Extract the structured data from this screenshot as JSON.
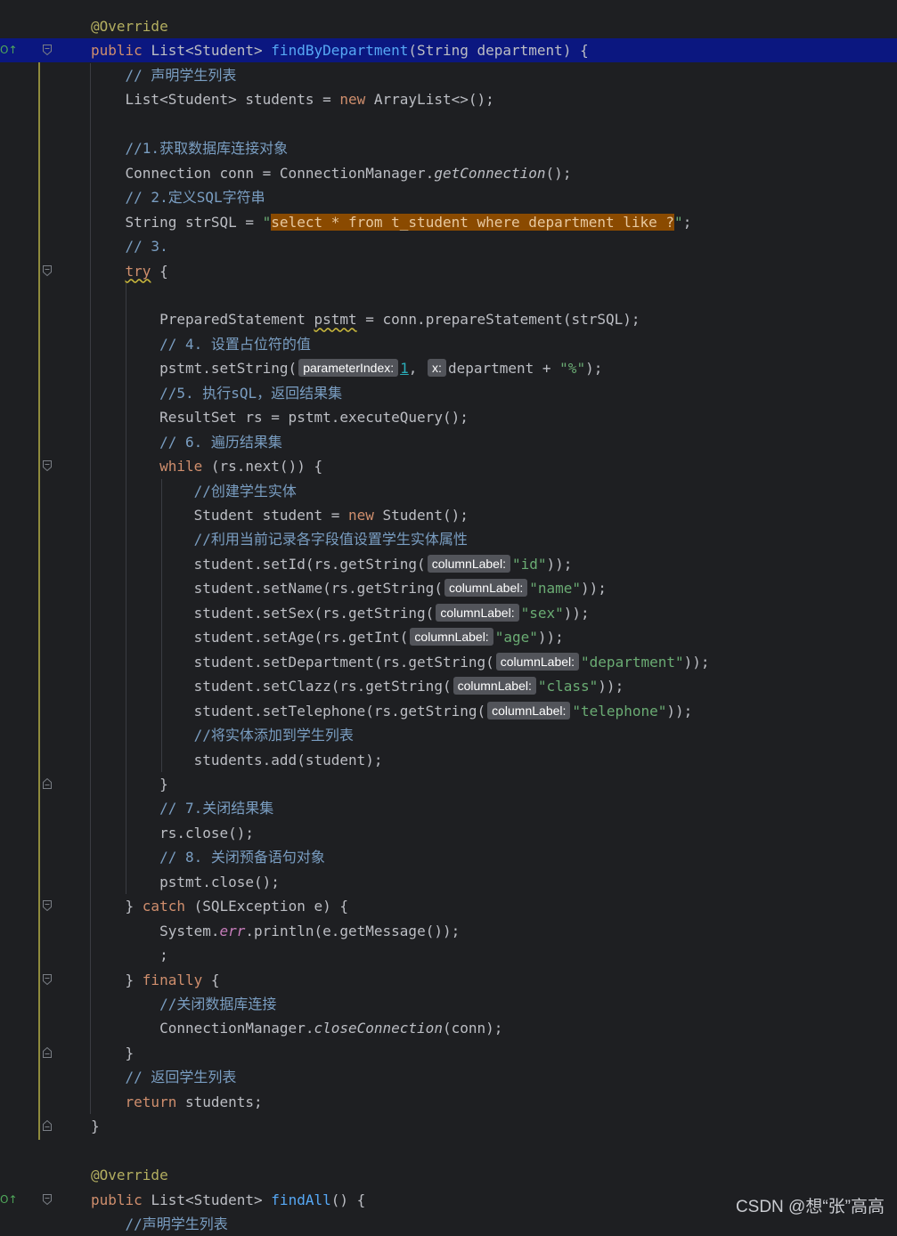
{
  "editor": {
    "lines": [
      [
        {
          "t": "@Override",
          "c": "a"
        }
      ],
      [
        {
          "t": "public ",
          "c": "k"
        },
        {
          "t": "List<Student> "
        },
        {
          "t": "findByDepartment",
          "c": "fn"
        },
        {
          "t": "(String department) {"
        }
      ],
      [
        {
          "t": "    // 声明学生列表",
          "c": "c"
        }
      ],
      [
        {
          "t": "    List<Student> students = "
        },
        {
          "t": "new ",
          "c": "k"
        },
        {
          "t": "ArrayList<>();"
        }
      ],
      [],
      [
        {
          "t": "    //1.获取数据库连接对象",
          "c": "c"
        }
      ],
      [
        {
          "t": "    Connection conn = ConnectionManager."
        },
        {
          "t": "getConnection",
          "c": "it"
        },
        {
          "t": "();"
        }
      ],
      [
        {
          "t": "    // 2.定义SQL字符串",
          "c": "c"
        }
      ],
      [
        {
          "t": "    String strSQL = "
        },
        {
          "t": "\"",
          "c": "s"
        },
        {
          "t": "select * from t_student where department like ?",
          "c": "hl"
        },
        {
          "t": "\"",
          "c": "s"
        },
        {
          "t": ";"
        }
      ],
      [
        {
          "t": "    // 3.",
          "c": "c"
        }
      ],
      [
        {
          "t": "    "
        },
        {
          "t": "try",
          "c": "k warn"
        },
        {
          "t": " {"
        }
      ],
      [],
      [
        {
          "t": "        PreparedStatement "
        },
        {
          "t": "pstmt",
          "c": "warn"
        },
        {
          "t": " = conn.prepareStatement(strSQL);"
        }
      ],
      [
        {
          "t": "        // 4. 设置占位符的值",
          "c": "c"
        }
      ],
      [
        {
          "t": "        pstmt.setString("
        },
        {
          "h": "parameterIndex:"
        },
        {
          "t": "1",
          "c": "num"
        },
        {
          "t": ", "
        },
        {
          "h": "x:"
        },
        {
          "t": "department + "
        },
        {
          "t": "\"%\"",
          "c": "s"
        },
        {
          "t": ");"
        }
      ],
      [
        {
          "t": "        //5. 执行sQL，返回结果集",
          "c": "c"
        }
      ],
      [
        {
          "t": "        ResultSet rs = pstmt.executeQuery();"
        }
      ],
      [
        {
          "t": "        // 6. 遍历结果集",
          "c": "c"
        }
      ],
      [
        {
          "t": "        "
        },
        {
          "t": "while",
          "c": "k"
        },
        {
          "t": " (rs.next()) {"
        }
      ],
      [
        {
          "t": "            //创建学生实体",
          "c": "c"
        }
      ],
      [
        {
          "t": "            Student student = "
        },
        {
          "t": "new ",
          "c": "k"
        },
        {
          "t": "Student();"
        }
      ],
      [
        {
          "t": "            //利用当前记录各字段值设置学生实体属性",
          "c": "c"
        }
      ],
      [
        {
          "t": "            student.setId(rs.getString("
        },
        {
          "h": "columnLabel:"
        },
        {
          "t": "\"id\"",
          "c": "s"
        },
        {
          "t": "));"
        }
      ],
      [
        {
          "t": "            student.setName(rs.getString("
        },
        {
          "h": "columnLabel:"
        },
        {
          "t": "\"name\"",
          "c": "s"
        },
        {
          "t": "));"
        }
      ],
      [
        {
          "t": "            student.setSex(rs.getString("
        },
        {
          "h": "columnLabel:"
        },
        {
          "t": "\"sex\"",
          "c": "s"
        },
        {
          "t": "));"
        }
      ],
      [
        {
          "t": "            student.setAge(rs.getInt("
        },
        {
          "h": "columnLabel:"
        },
        {
          "t": "\"age\"",
          "c": "s"
        },
        {
          "t": "));"
        }
      ],
      [
        {
          "t": "            student.setDepartment(rs.getString("
        },
        {
          "h": "columnLabel:"
        },
        {
          "t": "\"department\"",
          "c": "s"
        },
        {
          "t": "));"
        }
      ],
      [
        {
          "t": "            student.setClazz(rs.getString("
        },
        {
          "h": "columnLabel:"
        },
        {
          "t": "\"class\"",
          "c": "s"
        },
        {
          "t": "));"
        }
      ],
      [
        {
          "t": "            student.setTelephone(rs.getString("
        },
        {
          "h": "columnLabel:"
        },
        {
          "t": "\"telephone\"",
          "c": "s"
        },
        {
          "t": "));"
        }
      ],
      [
        {
          "t": "            //将实体添加到学生列表",
          "c": "c"
        }
      ],
      [
        {
          "t": "            students.add(student);"
        }
      ],
      [
        {
          "t": "        }"
        }
      ],
      [
        {
          "t": "        // 7.关闭结果集",
          "c": "c"
        }
      ],
      [
        {
          "t": "        rs.close();"
        }
      ],
      [
        {
          "t": "        // 8. 关闭预备语句对象",
          "c": "c"
        }
      ],
      [
        {
          "t": "        pstmt.close();"
        }
      ],
      [
        {
          "t": "    } "
        },
        {
          "t": "catch",
          "c": "k"
        },
        {
          "t": " (SQLException e) {"
        }
      ],
      [
        {
          "t": "        System."
        },
        {
          "t": "err",
          "c": "st"
        },
        {
          "t": ".println(e.getMessage());"
        }
      ],
      [
        {
          "t": "        ;"
        }
      ],
      [
        {
          "t": "    } "
        },
        {
          "t": "finally",
          "c": "k"
        },
        {
          "t": " {"
        }
      ],
      [
        {
          "t": "        //关闭数据库连接",
          "c": "c"
        }
      ],
      [
        {
          "t": "        ConnectionManager."
        },
        {
          "t": "closeConnection",
          "c": "it"
        },
        {
          "t": "(conn);"
        }
      ],
      [
        {
          "t": "    }"
        }
      ],
      [
        {
          "t": "    // 返回学生列表",
          "c": "c"
        }
      ],
      [
        {
          "t": "    "
        },
        {
          "t": "return",
          "c": "k"
        },
        {
          "t": " students;"
        }
      ],
      [
        {
          "t": "}"
        }
      ],
      [],
      [
        {
          "t": "@Override",
          "c": "a"
        }
      ],
      [
        {
          "t": "public ",
          "c": "k"
        },
        {
          "t": "List<Student> "
        },
        {
          "t": "findAll",
          "c": "fn"
        },
        {
          "t": "() {"
        }
      ],
      [
        {
          "t": "    //声明学生列表",
          "c": "c"
        }
      ]
    ]
  },
  "gutter": {
    "override_marker": "O↑",
    "current_line": 1,
    "override_lines": [
      1,
      48
    ],
    "fold_open_lines": [
      1,
      10,
      18,
      36,
      39,
      48
    ],
    "fold_close_lines": [
      31,
      36,
      39,
      42,
      45
    ]
  },
  "watermark": "CSDN @想“张”高高"
}
